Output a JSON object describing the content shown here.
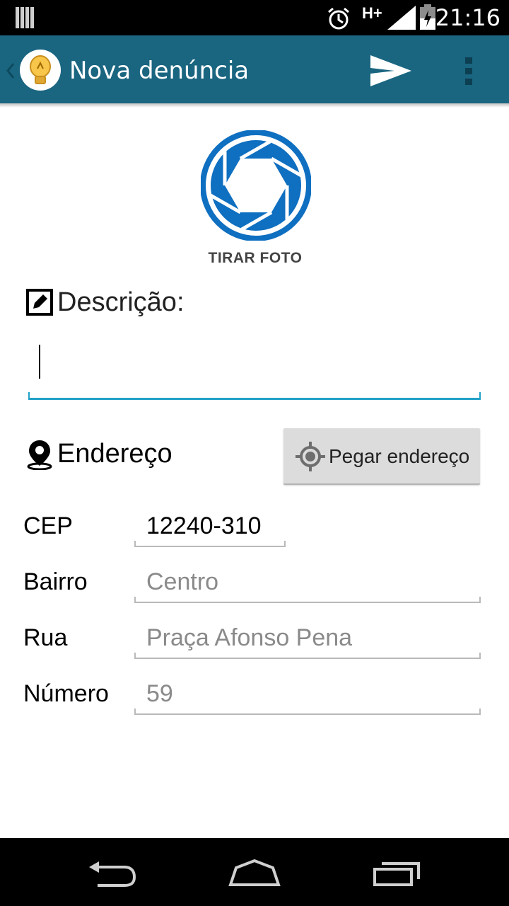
{
  "status_bar": {
    "time": "21:16",
    "network": "H+"
  },
  "action_bar": {
    "title": "Nova denúncia"
  },
  "photo": {
    "label": "TIRAR FOTO"
  },
  "description": {
    "label": "Descrição:",
    "value": ""
  },
  "address": {
    "label": "Endereço",
    "get_address_button": "Pegar endereço",
    "fields": {
      "cep": {
        "label": "CEP",
        "value": "12240-310"
      },
      "bairro": {
        "label": "Bairro",
        "value": "Centro"
      },
      "rua": {
        "label": "Rua",
        "value": "Praça Afonso Pena"
      },
      "numero": {
        "label": "Número",
        "value": "59"
      }
    }
  },
  "colors": {
    "action_bar": "#1a6580",
    "accent": "#22a1c8",
    "camera_blue": "#0f6fc0",
    "hint_gray": "#8a8a8a"
  }
}
